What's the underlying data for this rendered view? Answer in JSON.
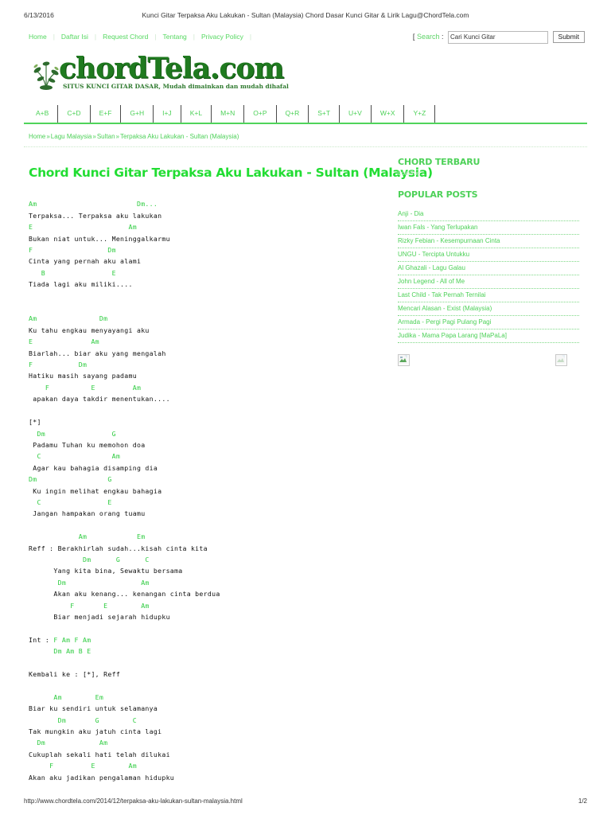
{
  "print": {
    "date": "6/13/2016",
    "title": "Kunci Gitar Terpaksa Aku Lakukan - Sultan (Malaysia) Chord Dasar Kunci Gitar & Lirik Lagu@ChordTela.com",
    "url": "http://www.chordtela.com/2014/12/terpaksa-aku-lakukan-sultan-malaysia.html",
    "page": "1/2"
  },
  "colors": {
    "link_green": "#4dd158",
    "title_green": "#22dd33",
    "chord_green": "#2ecc40",
    "logo_green": "#1f7a1f"
  },
  "topnav": {
    "items": [
      {
        "label": "Home"
      },
      {
        "label": "Daftar Isi"
      },
      {
        "label": "Request Chord"
      },
      {
        "label": "Tentang"
      },
      {
        "label": "Privacy Policy"
      }
    ]
  },
  "search": {
    "open_bracket": "[",
    "label": "Search",
    "colon": ":",
    "value": "Cari Kunci Gitar",
    "placeholder": "Cari Kunci Gitar",
    "submit_label": "Submit"
  },
  "logo": {
    "text": "chordTela.com",
    "tagline": "SITUS KUNCI GITAR DASAR, Mudah dimainkan dan mudah dihafal"
  },
  "alphabet_nav": {
    "items": [
      "A+B",
      "C+D",
      "E+F",
      "G+H",
      "I+J",
      "K+L",
      "M+N",
      "O+P",
      "Q+R",
      "S+T",
      "U+V",
      "W+X",
      "Y+Z"
    ]
  },
  "breadcrumb": {
    "separator": "»",
    "items": [
      "Home",
      "Lagu Malaysia",
      "Sultan",
      "Terpaksa Aku Lakukan - Sultan (Malaysia)"
    ]
  },
  "post": {
    "title": "Chord Kunci Gitar Terpaksa Aku Lakukan - Sultan (Malaysia)",
    "chord_text_lines": [
      {
        "type": "chord",
        "text": "Am                        Dm..."
      },
      {
        "type": "lyric",
        "text": "Terpaksa... Terpaksa aku lakukan"
      },
      {
        "type": "chord",
        "text": "E                       Am"
      },
      {
        "type": "lyric",
        "text": "Bukan niat untuk... Meninggalkarmu"
      },
      {
        "type": "chord",
        "text": "F                  Dm"
      },
      {
        "type": "lyric",
        "text": "Cinta yang pernah aku alami"
      },
      {
        "type": "chord",
        "text": "   B                E"
      },
      {
        "type": "lyric",
        "text": "Tiada lagi aku miliki...."
      },
      {
        "type": "blank",
        "text": ""
      },
      {
        "type": "blank",
        "text": ""
      },
      {
        "type": "chord",
        "text": "Am               Dm"
      },
      {
        "type": "lyric",
        "text": "Ku tahu engkau menyayangi aku"
      },
      {
        "type": "chord",
        "text": "E              Am"
      },
      {
        "type": "lyric",
        "text": "Biarlah... biar aku yang mengalah"
      },
      {
        "type": "chord",
        "text": "F           Dm"
      },
      {
        "type": "lyric",
        "text": "Hatiku masih sayang padamu"
      },
      {
        "type": "chord",
        "text": "    F          E         Am"
      },
      {
        "type": "lyric",
        "text": " apakan daya takdir menentukan...."
      },
      {
        "type": "blank",
        "text": ""
      },
      {
        "type": "plain",
        "text": "[*]"
      },
      {
        "type": "chord",
        "text": "  Dm                G"
      },
      {
        "type": "lyric",
        "text": " Padamu Tuhan ku memohon doa"
      },
      {
        "type": "chord",
        "text": "  C                 Am"
      },
      {
        "type": "lyric",
        "text": " Agar kau bahagia disamping dia"
      },
      {
        "type": "chord",
        "text": "Dm                 G"
      },
      {
        "type": "lyric",
        "text": " Ku ingin melihat engkau bahagia"
      },
      {
        "type": "chord",
        "text": "  C                E"
      },
      {
        "type": "lyric",
        "text": " Jangan hampakan orang tuamu"
      },
      {
        "type": "blank",
        "text": ""
      },
      {
        "type": "chord",
        "text": "            Am            Em"
      },
      {
        "type": "lyric",
        "text": "Reff : Berakhirlah sudah...kisah cinta kita"
      },
      {
        "type": "chord",
        "text": "             Dm      G      C"
      },
      {
        "type": "lyric",
        "text": "      Yang kita bina, Sewaktu bersama"
      },
      {
        "type": "chord",
        "text": "       Dm                  Am"
      },
      {
        "type": "lyric",
        "text": "      Akan aku kenang... kenangan cinta berdua"
      },
      {
        "type": "chord",
        "text": "          F       E        Am"
      },
      {
        "type": "lyric",
        "text": "      Biar menjadi sejarah hidupku"
      },
      {
        "type": "blank",
        "text": ""
      },
      {
        "type": "mixed",
        "text": "Int : F Am F Am"
      },
      {
        "type": "mixed",
        "text": "      Dm Am B E"
      },
      {
        "type": "blank",
        "text": ""
      },
      {
        "type": "plain",
        "text": "Kembali ke : [*], Reff"
      },
      {
        "type": "blank",
        "text": ""
      },
      {
        "type": "chord",
        "text": "      Am        Em"
      },
      {
        "type": "lyric",
        "text": "Biar ku sendiri untuk selamanya"
      },
      {
        "type": "chord",
        "text": "       Dm       G        C"
      },
      {
        "type": "lyric",
        "text": "Tak mungkin aku jatuh cinta lagi"
      },
      {
        "type": "chord",
        "text": "  Dm             Am"
      },
      {
        "type": "lyric",
        "text": "Cukuplah sekali hati telah dilukai"
      },
      {
        "type": "chord",
        "text": "     F         E        Am"
      },
      {
        "type": "lyric",
        "text": "Akan aku jadikan pengalaman hidupku"
      }
    ]
  },
  "sidebar": {
    "chord_terbaru": {
      "heading": "CHORD TERBARU",
      "loading": "Loading..."
    },
    "popular_posts": {
      "heading": "POPULAR POSTS",
      "items": [
        "Anji - Dia",
        "Iwan Fals - Yang Terlupakan",
        "Rizky Febian - Kesempurnaan Cinta",
        "UNGU - Tercipta Untukku",
        "Al Ghazali - Lagu Galau",
        "John Legend - All of Me",
        "Last Child - Tak Pernah Ternilai",
        "Mencari Alasan - Exist (Malaysia)",
        "Armada - Pergi Pagi Pulang Pagi",
        "Judika - Mama Papa Larang [MaPaLa]"
      ]
    },
    "broken_images": [
      "broken-image-icon",
      "broken-image-icon"
    ]
  }
}
